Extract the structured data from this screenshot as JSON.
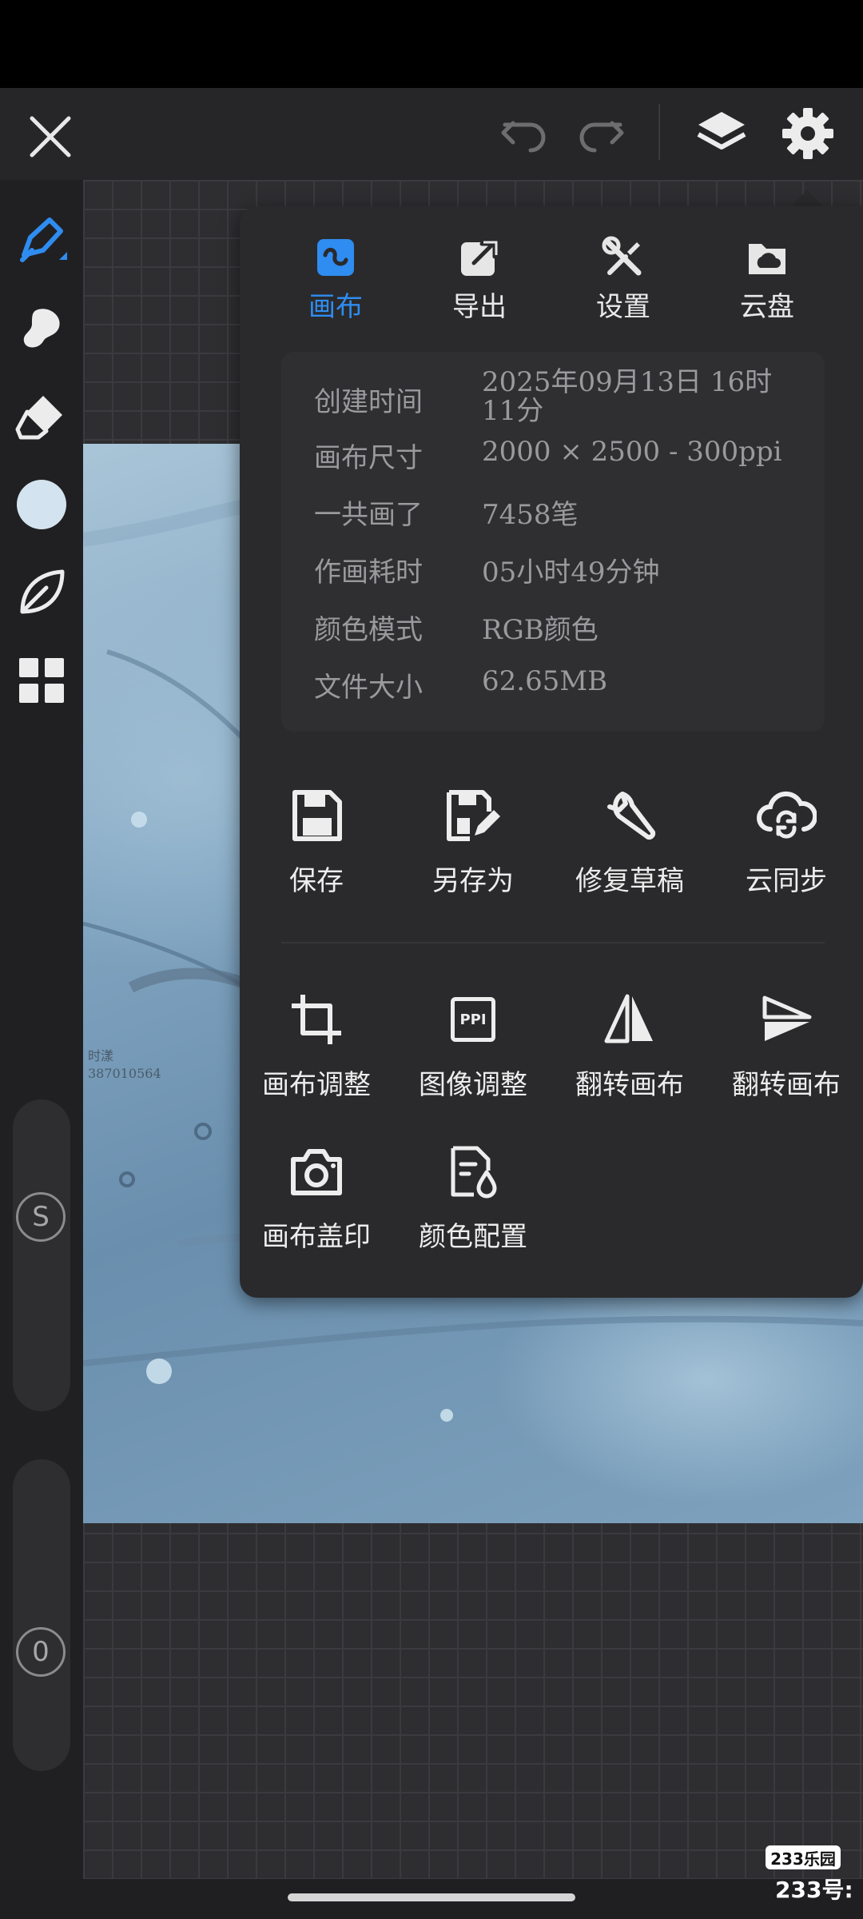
{
  "panel": {
    "tabs": [
      {
        "label": "画布",
        "icon": "canvas-wave-icon",
        "active": true
      },
      {
        "label": "导出",
        "icon": "export-icon",
        "active": false
      },
      {
        "label": "设置",
        "icon": "tools-icon",
        "active": false
      },
      {
        "label": "云盘",
        "icon": "cloud-folder-icon",
        "active": false
      }
    ],
    "info": [
      {
        "label": "创建时间",
        "value": "2025年09月13日 16时11分"
      },
      {
        "label": "画布尺寸",
        "value": "2000 × 2500 - 300ppi"
      },
      {
        "label": "一共画了",
        "value": "7458笔"
      },
      {
        "label": "作画耗时",
        "value": "05小时49分钟"
      },
      {
        "label": "颜色模式",
        "value": "RGB颜色"
      },
      {
        "label": "文件大小",
        "value": "62.65MB"
      }
    ],
    "actions_row1": [
      {
        "label": "保存",
        "icon": "save-icon"
      },
      {
        "label": "另存为",
        "icon": "save-as-icon"
      },
      {
        "label": "修复草稿",
        "icon": "wrench-icon"
      },
      {
        "label": "云同步",
        "icon": "cloud-sync-icon"
      }
    ],
    "actions_row2": [
      {
        "label": "画布调整",
        "icon": "crop-icon"
      },
      {
        "label": "图像调整",
        "icon": "ppi-icon",
        "icon_text": "PPI"
      },
      {
        "label": "翻转画布",
        "icon": "flip-horizontal-icon"
      },
      {
        "label": "翻转画布",
        "icon": "flip-vertical-icon"
      }
    ],
    "actions_row3": [
      {
        "label": "画布盖印",
        "icon": "camera-icon"
      },
      {
        "label": "颜色配置",
        "icon": "color-profile-icon"
      }
    ]
  },
  "left_toolbar": {
    "size_slider_label": "S",
    "opacity_slider_label": "0"
  },
  "artwork": {
    "signature_line1": "时漾",
    "signature_line2": "387010564"
  },
  "watermark": {
    "badge": "233乐园",
    "text": "233号:"
  },
  "colors": {
    "accent": "#2f8cf0",
    "panel_bg": "#2a2a2c",
    "info_text": "#9a9a9d"
  }
}
